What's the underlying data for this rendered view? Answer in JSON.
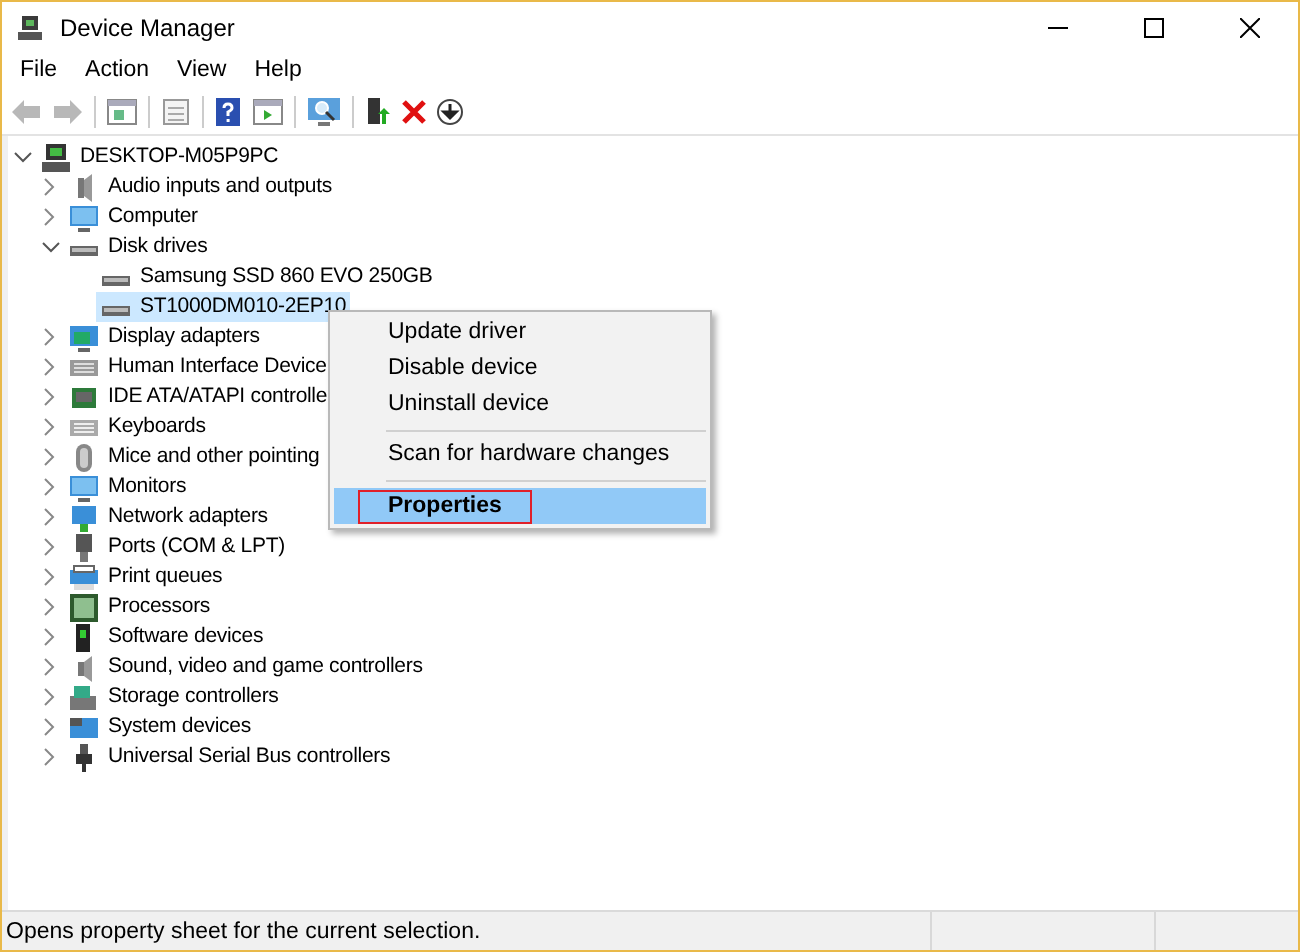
{
  "window": {
    "title": "Device Manager"
  },
  "menu": [
    "File",
    "Action",
    "View",
    "Help"
  ],
  "tree": {
    "label": "DESKTOP-M05P9PC",
    "expanded": true,
    "children": [
      {
        "label": "Audio inputs and outputs",
        "expanded": false,
        "selected": false
      },
      {
        "label": "Computer",
        "expanded": false,
        "selected": false
      },
      {
        "label": "Disk drives",
        "expanded": true,
        "selected": false,
        "children": [
          {
            "label": "Samsung SSD 860 EVO 250GB",
            "selected": false
          },
          {
            "label": "ST1000DM010-2EP10",
            "selected": true
          }
        ]
      },
      {
        "label": "Display adapters",
        "expanded": false,
        "selected": false
      },
      {
        "label": "Human Interface Device",
        "expanded": false,
        "selected": false
      },
      {
        "label": "IDE ATA/ATAPI controlle",
        "expanded": false,
        "selected": false
      },
      {
        "label": "Keyboards",
        "expanded": false,
        "selected": false
      },
      {
        "label": "Mice and other pointing",
        "expanded": false,
        "selected": false
      },
      {
        "label": "Monitors",
        "expanded": false,
        "selected": false
      },
      {
        "label": "Network adapters",
        "expanded": false,
        "selected": false
      },
      {
        "label": "Ports (COM & LPT)",
        "expanded": false,
        "selected": false
      },
      {
        "label": "Print queues",
        "expanded": false,
        "selected": false
      },
      {
        "label": "Processors",
        "expanded": false,
        "selected": false
      },
      {
        "label": "Software devices",
        "expanded": false,
        "selected": false
      },
      {
        "label": "Sound, video and game controllers",
        "expanded": false,
        "selected": false
      },
      {
        "label": "Storage controllers",
        "expanded": false,
        "selected": false
      },
      {
        "label": "System devices",
        "expanded": false,
        "selected": false
      },
      {
        "label": "Universal Serial Bus controllers",
        "expanded": false,
        "selected": false
      }
    ]
  },
  "context_menu": [
    {
      "kind": "item",
      "label": "Update driver",
      "selected": false
    },
    {
      "kind": "item",
      "label": "Disable device",
      "selected": false
    },
    {
      "kind": "item",
      "label": "Uninstall device",
      "selected": false
    },
    {
      "kind": "separator"
    },
    {
      "kind": "item",
      "label": "Scan for hardware changes",
      "selected": false
    },
    {
      "kind": "separator"
    },
    {
      "kind": "item",
      "label": "Properties",
      "selected": true
    }
  ],
  "status_bar": {
    "text": "Opens property sheet for the current selection."
  }
}
